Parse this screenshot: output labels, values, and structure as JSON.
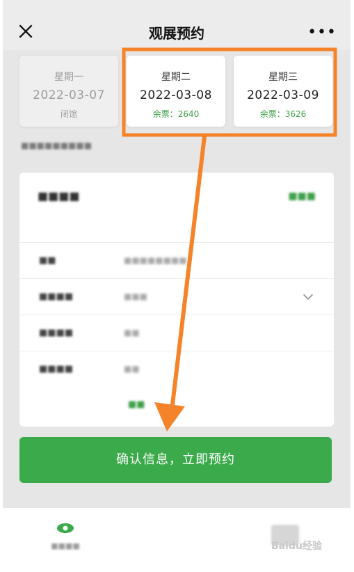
{
  "header": {
    "title": "观展预约"
  },
  "dates": [
    {
      "weekday": "星期一",
      "date": "2022-03-07",
      "status": "闭馆"
    },
    {
      "weekday": "星期二",
      "date": "2022-03-08",
      "status": "余票：2640"
    },
    {
      "weekday": "星期三",
      "date": "2022-03-09",
      "status": "余票：3626"
    }
  ],
  "confirm_label": "确认信息，立即预约",
  "watermark": "Baidu经验",
  "colors": {
    "accent": "#3aaa4a",
    "annotation": "#f5832a"
  }
}
